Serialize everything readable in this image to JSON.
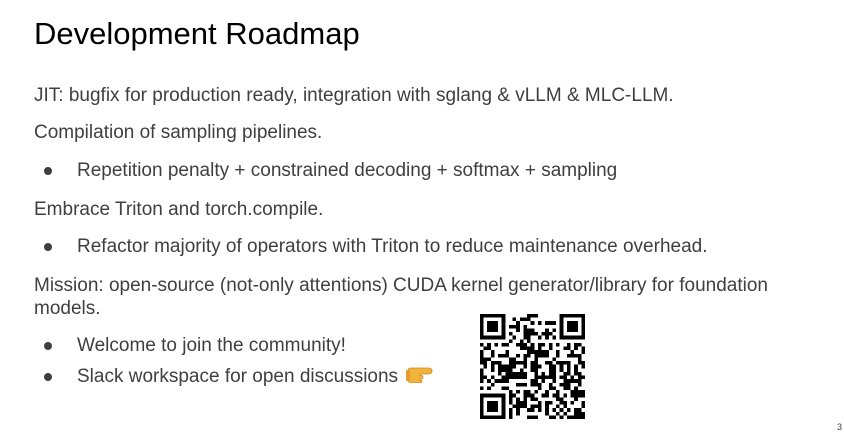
{
  "slide": {
    "title": "Development Roadmap",
    "jit_line": "JIT: bugfix for production ready, integration with sglang & vLLM & MLC-LLM.",
    "sampling_heading": "Compilation of sampling pipelines.",
    "sampling_bullet": "Repetition penalty + constrained decoding + softmax + sampling",
    "triton_heading": "Embrace Triton and torch.compile.",
    "triton_bullet": "Refactor majority of operators with Triton to reduce maintenance overhead.",
    "mission": "Mission: open-source (not-only attentions) CUDA kernel generator/library for foundation models.",
    "community_bullets": [
      "Welcome to join the community!",
      "Slack workspace for open discussions"
    ],
    "page_number": "3"
  },
  "icons": {
    "pointing_hand": "pointing-right-hand-icon",
    "qr": "qr-code"
  },
  "colors": {
    "title": "#000000",
    "body_text": "#3f3f3f",
    "background": "#ffffff",
    "emoji_hand": "#f2b33d"
  }
}
